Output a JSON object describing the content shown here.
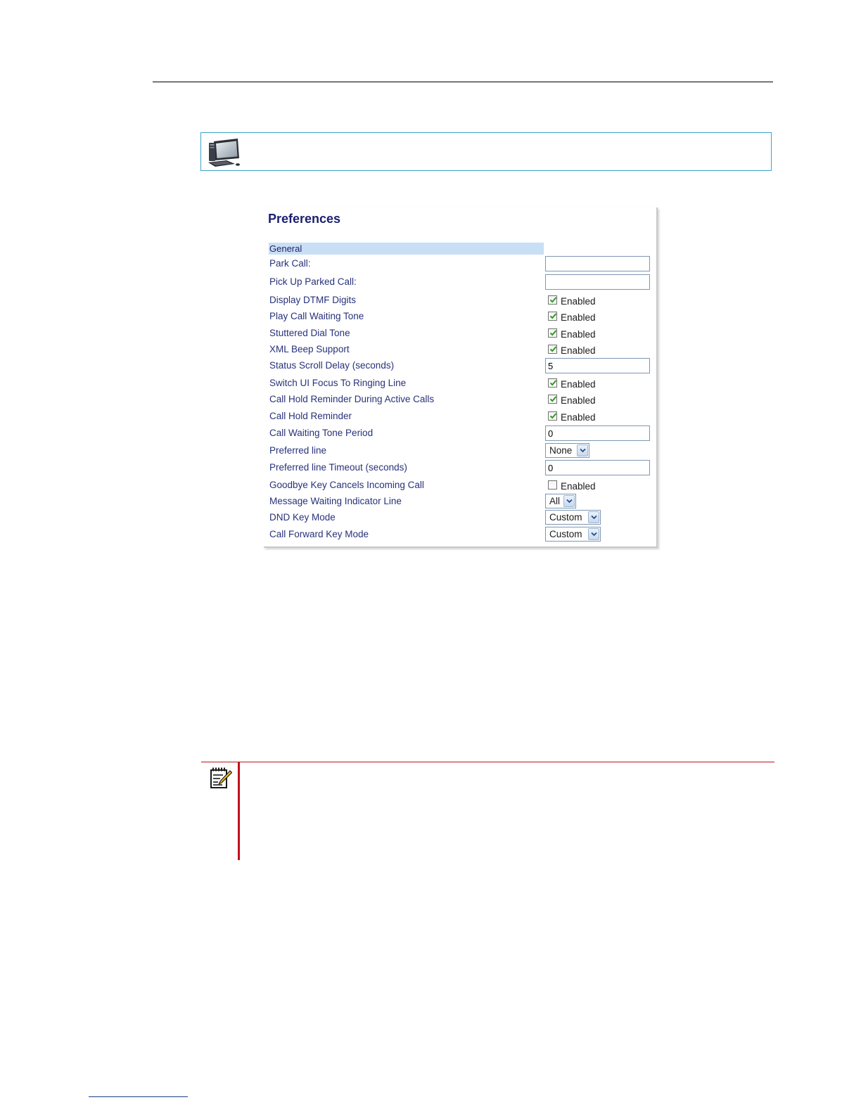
{
  "panel": {
    "title": "Preferences",
    "section": "General"
  },
  "rows": [
    {
      "label": "Park Call:",
      "type": "text",
      "value": ""
    },
    {
      "label": "Pick Up Parked Call:",
      "type": "text",
      "value": ""
    },
    {
      "label": "Display DTMF Digits",
      "type": "checkbox",
      "checked": true,
      "option": "Enabled"
    },
    {
      "label": "Play Call Waiting Tone",
      "type": "checkbox",
      "checked": true,
      "option": "Enabled"
    },
    {
      "label": "Stuttered Dial Tone",
      "type": "checkbox",
      "checked": true,
      "option": "Enabled"
    },
    {
      "label": "XML Beep Support",
      "type": "checkbox",
      "checked": true,
      "option": "Enabled"
    },
    {
      "label": "Status Scroll Delay (seconds)",
      "type": "text",
      "value": "5"
    },
    {
      "label": "Switch UI Focus To Ringing Line",
      "type": "checkbox",
      "checked": true,
      "option": "Enabled"
    },
    {
      "label": "Call Hold Reminder During Active Calls",
      "type": "checkbox",
      "checked": true,
      "option": "Enabled"
    },
    {
      "label": "Call Hold Reminder",
      "type": "checkbox",
      "checked": true,
      "option": "Enabled"
    },
    {
      "label": "Call Waiting Tone Period",
      "type": "text",
      "value": "0"
    },
    {
      "label": "Preferred line",
      "type": "select",
      "value": "None"
    },
    {
      "label": "Preferred line Timeout (seconds)",
      "type": "text",
      "value": "0"
    },
    {
      "label": "Goodbye Key Cancels Incoming Call",
      "type": "checkbox",
      "checked": false,
      "option": "Enabled"
    },
    {
      "label": "Message Waiting Indicator Line",
      "type": "select",
      "value": "All"
    },
    {
      "label": "DND Key Mode",
      "type": "select",
      "value": "Custom"
    },
    {
      "label": "Call Forward Key Mode",
      "type": "select",
      "value": "Custom"
    }
  ],
  "colors": {
    "title": "#1c1f6e",
    "label": "#27317a",
    "section_bg": "#c8dff5",
    "info_border": "#3aa6c7",
    "note_accent": "#c0111b",
    "check": "#2f9a1e"
  },
  "icons": {
    "web_ui": "computer-monitor-icon",
    "note": "notepad-pencil-icon"
  }
}
